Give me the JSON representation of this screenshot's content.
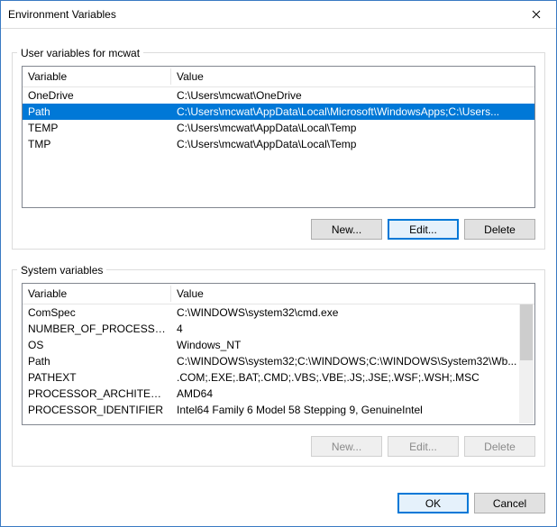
{
  "window": {
    "title": "Environment Variables"
  },
  "userGroup": {
    "label": "User variables for mcwat",
    "columns": {
      "variable": "Variable",
      "value": "Value"
    },
    "rows": [
      {
        "variable": "OneDrive",
        "value": "C:\\Users\\mcwat\\OneDrive"
      },
      {
        "variable": "Path",
        "value": "C:\\Users\\mcwat\\AppData\\Local\\Microsoft\\WindowsApps;C:\\Users..."
      },
      {
        "variable": "TEMP",
        "value": "C:\\Users\\mcwat\\AppData\\Local\\Temp"
      },
      {
        "variable": "TMP",
        "value": "C:\\Users\\mcwat\\AppData\\Local\\Temp"
      }
    ],
    "selectedIndex": 1,
    "buttons": {
      "new": "New...",
      "edit": "Edit...",
      "delete": "Delete"
    }
  },
  "systemGroup": {
    "label": "System variables",
    "columns": {
      "variable": "Variable",
      "value": "Value"
    },
    "rows": [
      {
        "variable": "ComSpec",
        "value": "C:\\WINDOWS\\system32\\cmd.exe"
      },
      {
        "variable": "NUMBER_OF_PROCESSORS",
        "value": "4"
      },
      {
        "variable": "OS",
        "value": "Windows_NT"
      },
      {
        "variable": "Path",
        "value": "C:\\WINDOWS\\system32;C:\\WINDOWS;C:\\WINDOWS\\System32\\Wb..."
      },
      {
        "variable": "PATHEXT",
        "value": ".COM;.EXE;.BAT;.CMD;.VBS;.VBE;.JS;.JSE;.WSF;.WSH;.MSC"
      },
      {
        "variable": "PROCESSOR_ARCHITECTURE",
        "value": "AMD64"
      },
      {
        "variable": "PROCESSOR_IDENTIFIER",
        "value": "Intel64 Family 6 Model 58 Stepping 9, GenuineIntel"
      }
    ],
    "selectedIndex": -1,
    "buttons": {
      "new": "New...",
      "edit": "Edit...",
      "delete": "Delete"
    }
  },
  "dialog": {
    "ok": "OK",
    "cancel": "Cancel"
  }
}
